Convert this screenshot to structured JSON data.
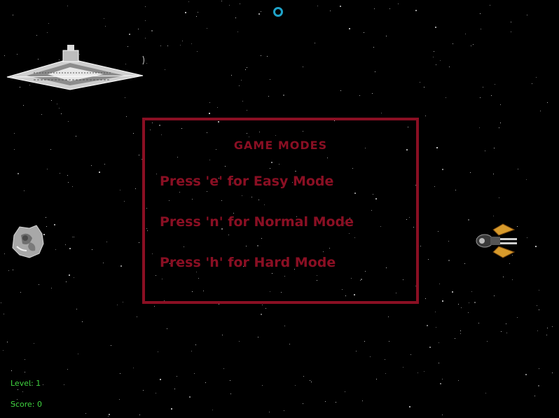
{
  "menu": {
    "title": "GAME MODES",
    "options": [
      {
        "key": "e",
        "label": "Press 'e' for Easy Mode"
      },
      {
        "key": "n",
        "label": "Press 'n' for Normal Mode"
      },
      {
        "key": "h",
        "label": "Press 'h' for Hard Mode"
      }
    ]
  },
  "hud": {
    "level": "Level: 1",
    "score": "Score: 0"
  },
  "colors": {
    "menu_accent": "#8a0f23",
    "hud_text": "#3fd43f",
    "target_ring": "#1fa3c9",
    "background": "#000000"
  },
  "sprites": [
    "star-destroyer-sprite",
    "asteroid-sprite",
    "player-ship-sprite",
    "target-ring-icon"
  ]
}
